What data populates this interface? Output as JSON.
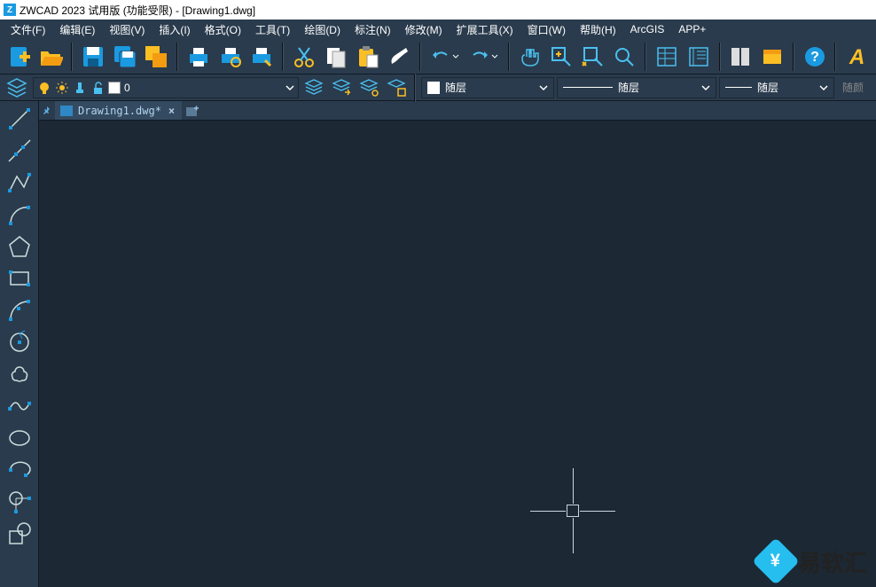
{
  "title": "ZWCAD 2023 试用版 (功能受限) - [Drawing1.dwg]",
  "menus": [
    "文件(F)",
    "编辑(E)",
    "视图(V)",
    "插入(I)",
    "格式(O)",
    "工具(T)",
    "绘图(D)",
    "标注(N)",
    "修改(M)",
    "扩展工具(X)",
    "窗口(W)",
    "帮助(H)",
    "ArcGIS",
    "APP+"
  ],
  "tab": {
    "label": "Drawing1.dwg*"
  },
  "layer": {
    "current": "0"
  },
  "colorprop": "随层",
  "linetypeprop": "随层",
  "lineweightprop": "随层",
  "rightlabel": "随颜",
  "watermark": "易软汇",
  "toolbar1_icons": [
    "new",
    "open",
    "save",
    "saveas",
    "copydoc",
    "print",
    "preview",
    "plot",
    "cut",
    "copy",
    "paste",
    "matchprop",
    "undo",
    "redo",
    "pan",
    "zoomwin",
    "zoomprev",
    "zoomrt",
    "grid",
    "table",
    "hatch",
    "blocks",
    "help",
    "text"
  ],
  "toolbar2_icons": [
    "layermgr",
    "bulb",
    "freeze",
    "lock",
    "unlock"
  ],
  "layer_btns": [
    "layers1",
    "layers2",
    "layers3",
    "layers4"
  ],
  "left_tools": [
    "line",
    "xline",
    "ray",
    "arc",
    "polygon",
    "rectangle",
    "spline",
    "circle-arc",
    "revcloud",
    "wave",
    "circle",
    "circle2",
    "measure",
    "region"
  ]
}
